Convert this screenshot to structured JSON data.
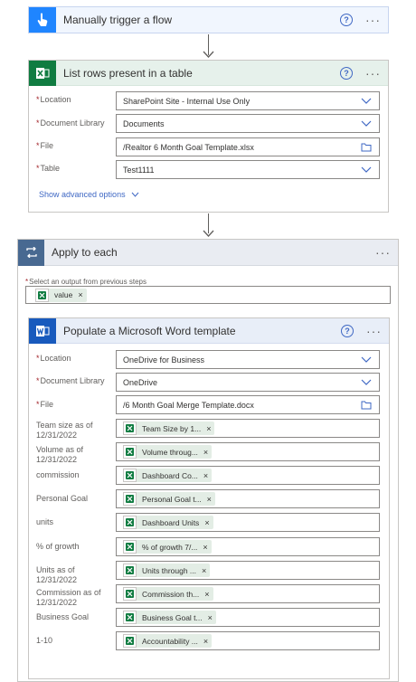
{
  "trigger": {
    "title": "Manually trigger a flow"
  },
  "list_rows": {
    "title": "List rows present in a table",
    "fields": [
      {
        "label": "Location",
        "value": "SharePoint Site - Internal Use Only",
        "kind": "dropdown"
      },
      {
        "label": "Document Library",
        "value": "Documents",
        "kind": "dropdown"
      },
      {
        "label": "File",
        "value": "/Realtor 6 Month Goal Template.xlsx",
        "kind": "file"
      },
      {
        "label": "Table",
        "value": "Test1111",
        "kind": "dropdown"
      }
    ],
    "advanced_link": "Show advanced options"
  },
  "apply_each": {
    "title": "Apply to each",
    "select_label": "Select an output from previous steps",
    "token": "value"
  },
  "populate": {
    "title": "Populate a Microsoft Word template",
    "fields": [
      {
        "label": "Location",
        "value": "OneDrive for Business",
        "kind": "dropdown"
      },
      {
        "label": "Document Library",
        "value": "OneDrive",
        "kind": "dropdown"
      },
      {
        "label": "File",
        "value": "/6 Month Goal Merge Template.docx",
        "kind": "file"
      }
    ],
    "mappings": [
      {
        "label": "Team size as of 12/31/2022",
        "token": "Team Size by 1..."
      },
      {
        "label": "Volume as of 12/31/2022",
        "token": "Volume throug..."
      },
      {
        "label": "commission",
        "token": "Dashboard Co..."
      },
      {
        "label": "Personal Goal",
        "token": "Personal Goal t..."
      },
      {
        "label": "units",
        "token": "Dashboard Units"
      },
      {
        "label": "% of growth",
        "token": "% of growth 7/..."
      },
      {
        "label": "Units as of 12/31/2022",
        "token": "Units through ..."
      },
      {
        "label": "Commission as of 12/31/2022",
        "token": "Commission th..."
      },
      {
        "label": "Business Goal",
        "token": "Business Goal t..."
      },
      {
        "label": "1-10",
        "token": "Accountability ..."
      }
    ]
  },
  "common": {
    "help_glyph": "?",
    "more_glyph": "···",
    "token_close": "×"
  },
  "colors": {
    "trigger_accent": "#1f85ff",
    "excel_green": "#107c41",
    "word_blue": "#185abd",
    "loop_slate": "#486991",
    "link_blue": "#3f68c4",
    "required_red": "#a4262c",
    "token_bg": "#e3ede5"
  },
  "icons": {
    "trigger": "touch-hand-icon",
    "excel": "excel-icon",
    "word": "word-icon",
    "loop": "loop-icon",
    "chevron": "chevron-down-icon",
    "folder": "folder-icon"
  }
}
